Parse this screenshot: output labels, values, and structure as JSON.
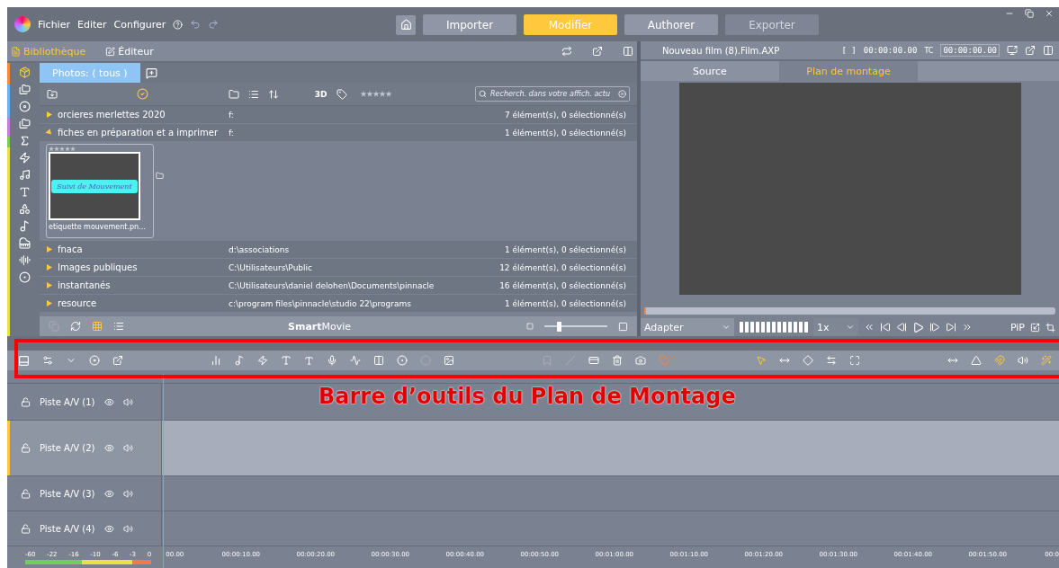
{
  "menu": [
    {
      "label": "Fichier"
    },
    {
      "label": "Editer"
    },
    {
      "label": "Configurer"
    }
  ],
  "modes": [
    {
      "label": "Importer",
      "selected": false,
      "disabled": false
    },
    {
      "label": "Modifier",
      "selected": true,
      "disabled": false
    },
    {
      "label": "Authorer",
      "selected": false,
      "disabled": false
    },
    {
      "label": "Exporter",
      "selected": false,
      "disabled": true
    }
  ],
  "panel_tabs": [
    {
      "label": "Bibliothèque",
      "selected": true
    },
    {
      "label": "Éditeur",
      "selected": false
    }
  ],
  "library": {
    "tab": "Photos: ( tous )",
    "toggle_3d": "3D",
    "search": {
      "placeholder": "Recherch. dans votre affich. actu"
    },
    "rows": [
      {
        "name": "orcieres merlettes 2020",
        "path": "f:",
        "count": "7 élément(s), 0 sélectionné(s)",
        "expanded": false
      },
      {
        "name": "fiches en préparation et a imprimer",
        "path": "f:",
        "count": "1 élément(s), 0 sélectionné(s)",
        "expanded": true,
        "thumbnail": {
          "label": "Suivi de Mouvement",
          "caption": "etiquette mouvement.pn..."
        }
      },
      {
        "name": "fnaca",
        "path": "d:\\associations",
        "count": "1 élément(s), 0 sélectionné(s)",
        "expanded": false
      },
      {
        "name": "Images publiques",
        "path": "C:\\Utilisateurs\\Public",
        "count": "12 élément(s), 0 sélectionné(s)",
        "expanded": false
      },
      {
        "name": "instantanés",
        "path": "C:\\Utilisateurs\\daniel delohen\\Documents\\pinnacle",
        "count": "16 élément(s), 0 sélectionné(s)",
        "expanded": false
      },
      {
        "name": "resource",
        "path": "c:\\program files\\pinnacle\\studio 22\\programs",
        "count": "1 élément(s), 0 sélectionné(s)",
        "expanded": false
      }
    ],
    "bottom_title": "**Smart**Movie",
    "zoom": {
      "level": 0.2
    }
  },
  "preview": {
    "title": "Nouveau film (8).Film.AXP",
    "duration_mark": "[ ]",
    "duration": "00:00:00.00",
    "tc_label": "TC",
    "tc": "00:00:00.00",
    "tabs": [
      {
        "label": "Source",
        "selected": false
      },
      {
        "label": "Plan de montage",
        "selected": true
      }
    ],
    "scrubber": {
      "level": 0
    },
    "fit": "Adapter",
    "speed": "1x",
    "pip": "PiP"
  },
  "tracks": [
    {
      "name": "Piste A/V (1)",
      "selected": false
    },
    {
      "name": "Piste A/V (2)",
      "selected": true
    },
    {
      "name": "Piste A/V (3)",
      "selected": false
    },
    {
      "name": "Piste A/V (4)",
      "selected": false
    }
  ],
  "meter_labels": [
    "-60",
    "-22",
    "-16",
    "-10",
    "-6",
    "-3",
    "0"
  ],
  "ruler": [
    "00.00",
    "00:00:10.00",
    "00:00:20.00",
    "00:00:30.00",
    "00:00:40.00",
    "00:00:50.00",
    "00:01:00.00",
    "00:01:10.00",
    "00:01:20.00",
    "00:01:30.00",
    "00:01:40.00",
    "00:01:50.00",
    "00:0"
  ],
  "annotation": {
    "text": "Barre d’outils du Plan de Montage"
  }
}
